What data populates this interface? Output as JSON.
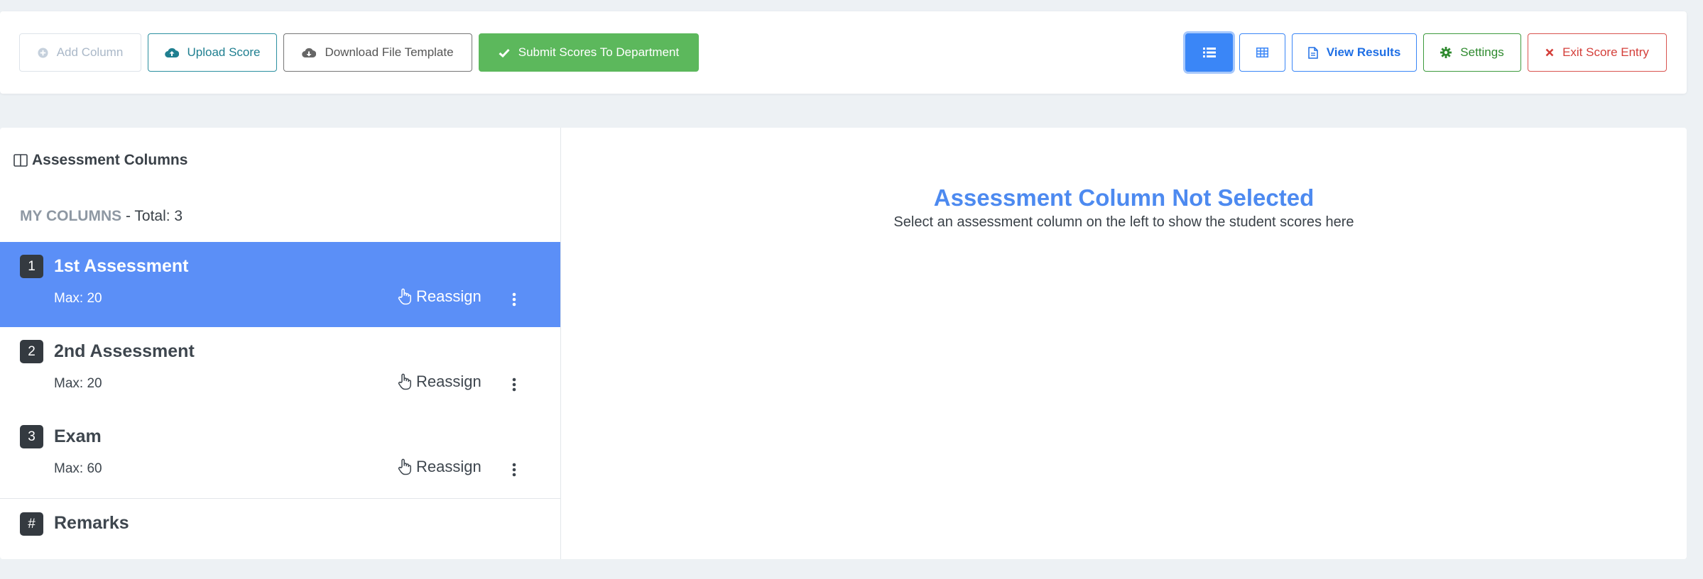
{
  "toolbar": {
    "add_column": "Add Column",
    "upload_score": "Upload Score",
    "download_template": "Download File Template",
    "submit_scores": "Submit Scores To Department",
    "view_results": "View Results",
    "settings": "Settings",
    "exit": "Exit Score Entry"
  },
  "sidebar": {
    "title": "Assessment Columns",
    "section_label": "MY COLUMNS",
    "total_text": " - Total: 3",
    "items": [
      {
        "number": "1",
        "title": "1st Assessment",
        "max": "Max: 20",
        "action": "Reassign",
        "active": true
      },
      {
        "number": "2",
        "title": "2nd Assessment",
        "max": "Max: 20",
        "action": "Reassign",
        "active": false
      },
      {
        "number": "3",
        "title": "Exam",
        "max": "Max: 60",
        "action": "Reassign",
        "active": false
      }
    ],
    "remarks": {
      "badge": "#",
      "title": "Remarks"
    }
  },
  "content": {
    "empty_title": "Assessment Column Not Selected",
    "empty_desc": "Select an assessment column on the left to show the student scores here"
  },
  "colors": {
    "primary": "#3a86f7",
    "active_item": "#5b8ff7",
    "success": "#5cb85c",
    "danger": "#d9534f",
    "info": "#2b8fa0"
  },
  "icons": [
    "plus-circle-icon",
    "cloud-upload-icon",
    "cloud-download-icon",
    "check-icon",
    "list-icon",
    "table-icon",
    "document-icon",
    "gear-icon",
    "close-icon",
    "columns-icon",
    "hand-pointer-icon",
    "kebab-icon"
  ]
}
